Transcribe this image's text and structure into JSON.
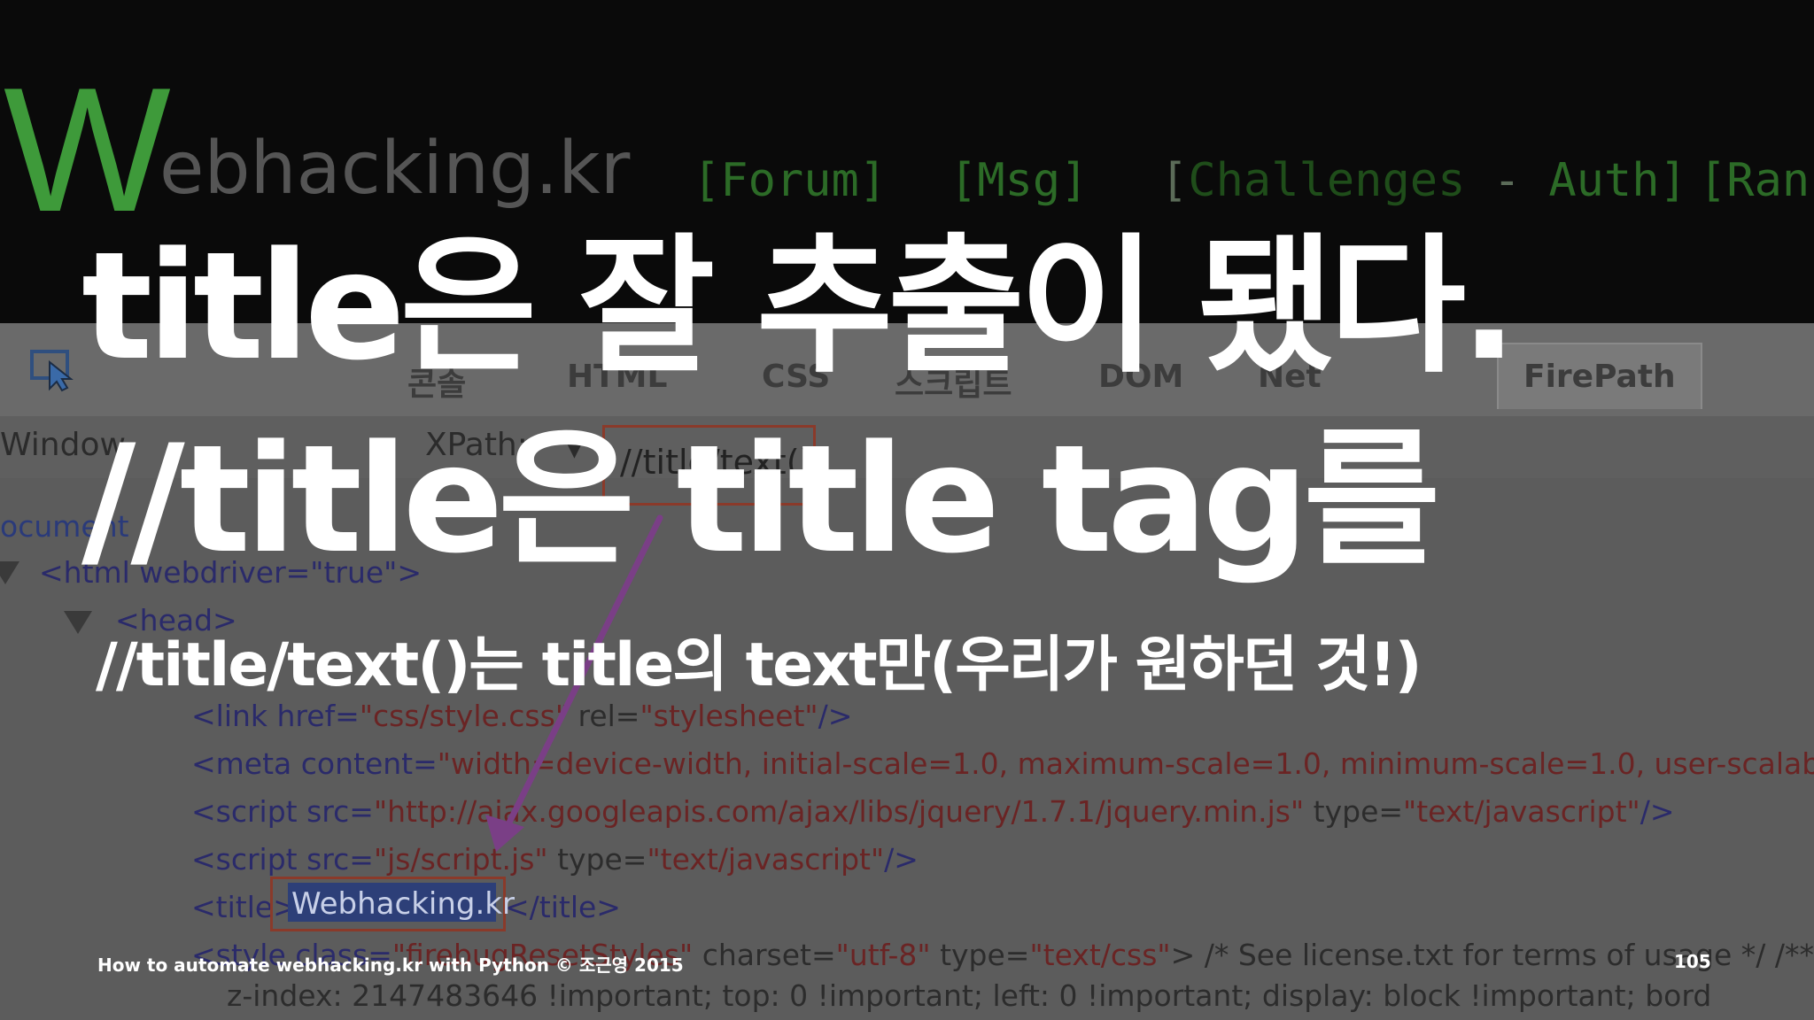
{
  "slide": {
    "line1": "title은 잘 추출이 됐다.",
    "line2": "//title은 title tag를",
    "line3": "//title/text()는 title의 text만(우리가 원하던 것!)",
    "footer": "How to automate webhacking.kr with Python © 조근영 2015",
    "page_number": "105"
  },
  "background_site": {
    "logo_initial": "W",
    "logo_rest": "ebhacking.kr",
    "nav": {
      "forum": "[Forum]",
      "msg": "[Msg]",
      "challenges_open": "[",
      "challenges": "Challenges",
      "challenges_sep": " - ",
      "auth": "Auth]",
      "rank": "[Rank"
    }
  },
  "devtools": {
    "tabs": {
      "console_partial": "콘솔",
      "html": "HTML",
      "css": "CSS",
      "script": "스크립트",
      "dom": "DOM",
      "net": "Net",
      "firepath": "FirePath"
    },
    "toolbar": {
      "window_label": "Window",
      "xpath_label": "XPath:",
      "xpath_value": "//title/text()"
    },
    "tree": {
      "document": "ocument",
      "html_open": "<html webdriver=\"true\">",
      "head_open": "<head>",
      "link_line": {
        "tag": "<link href=",
        "href": "\"css/style.css\"",
        "rel_attr": " rel=",
        "rel": "\"stylesheet\"",
        "close": "/>"
      },
      "meta_line": {
        "tag": "<meta content=",
        "content": "\"width=device-width, initial-scale=1.0, maximum-scale=1.0, minimum-scale=1.0, user-scalable=no, t"
      },
      "script1_line": {
        "tag": "<script src=",
        "src": "\"http://ajax.googleapis.com/ajax/libs/jquery/1.7.1/jquery.min.js\"",
        "type_attr": " type=",
        "type": "\"text/javascript\"",
        "close": "/>"
      },
      "script2_line": {
        "tag": "<script src=",
        "src": "\"js/script.js\"",
        "type_attr": " type=",
        "type": "\"text/javascript\"",
        "close": "/>"
      },
      "title_line": {
        "open": "<title>",
        "text": "Webhacking.kr",
        "close": "</title>"
      },
      "style_line": {
        "tag": "<style class=",
        "class": "\"firebugResetStyles\"",
        "charset_attr": " charset=",
        "charset": "\"utf-8\"",
        "type_attr": " type=",
        "type": "\"text/css\"",
        "comment": "> /* See license.txt for terms of usage */ /** reset s"
      },
      "css_line": "z-index: 2147483646 !important;   top: 0 !important;   left: 0 !important;   display: block !important;   bord"
    }
  },
  "colors": {
    "background": "#050505",
    "slide_text": "#ffffff",
    "logo_green": "#3e9a3a",
    "highlight_border": "#8a3a2a",
    "arrow": "#7a3f86"
  }
}
